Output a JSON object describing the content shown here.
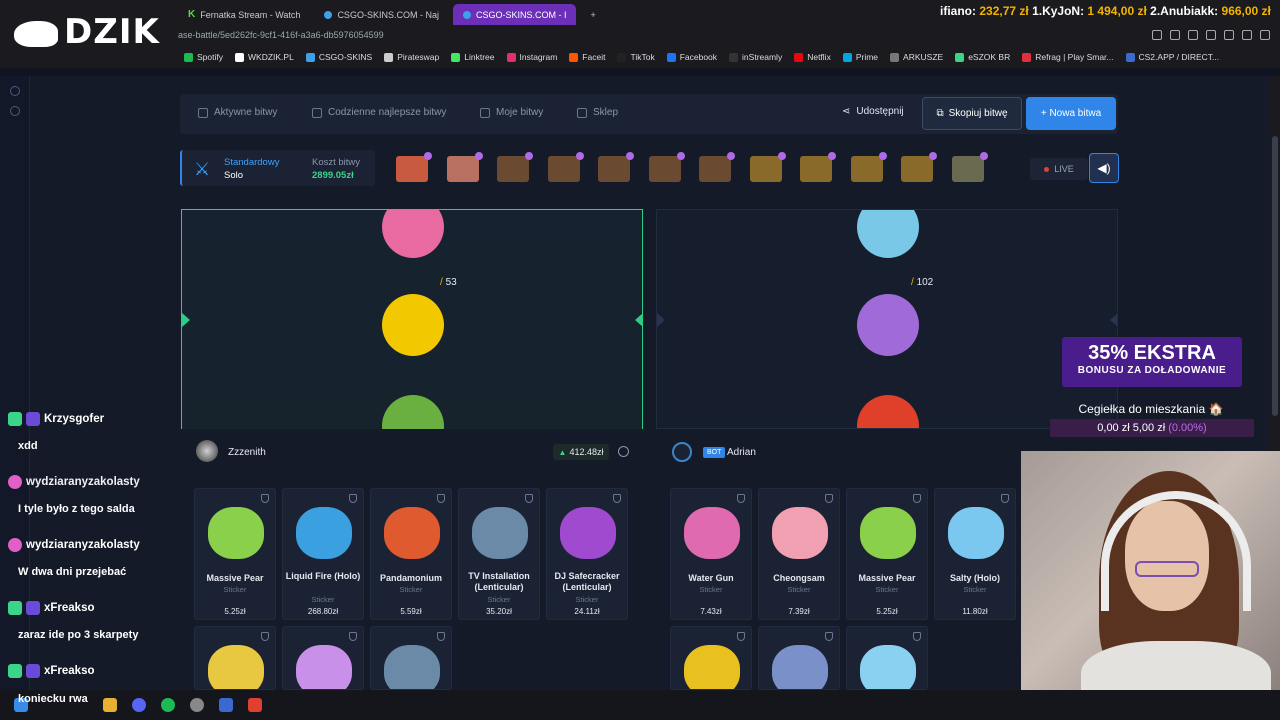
{
  "browser": {
    "logo": "DZIK",
    "tabs": [
      {
        "label": "Fernatka Stream - Watch",
        "active": false
      },
      {
        "label": "CSGO-SKINS.COM - Naj",
        "active": false
      },
      {
        "label": "CSGO-SKINS.COM - I",
        "active": true
      }
    ],
    "url": "ase-battle/5ed262fc-9cf1-416f-a3a6-db5976054599",
    "ticker": {
      "label": "ifiano:",
      "v1": "232,77 zł",
      "t2": "1.KyJoN:",
      "v2": "1 494,00 zł",
      "t3": "2.Anubiakk:",
      "v3": "966,00 zł"
    },
    "bookmarks": [
      "Spotify",
      "WKDZIK.PL",
      "CSGO-SKINS",
      "Pirateswap",
      "Linktree",
      "Instagram",
      "Faceit",
      "TikTok",
      "Facebook",
      "inStreamly",
      "Netflix",
      "Prime",
      "ARKUSZE",
      "eSZOK BR",
      "Refrag | Play Smar...",
      "CS2.APP / DIRECT..."
    ]
  },
  "nav": {
    "items": [
      "Aktywne bitwy",
      "Codzienne najlepsze bitwy",
      "Moje bitwy",
      "Sklep"
    ],
    "share": "Udostępnij",
    "copy": "Skopiuj bitwę",
    "new": "+ Nowa bitwa"
  },
  "mode": {
    "type": "Standardowy",
    "sub": "Solo",
    "cost_label": "Koszt bitwy",
    "cost": "2899.05zł"
  },
  "live": "LIVE",
  "reels": {
    "left_value": "53",
    "right_value": "102"
  },
  "players": {
    "p1": {
      "name": "Zzzenith",
      "total": "412.48zł"
    },
    "p2": {
      "bot": "BOT",
      "name": "Adrian"
    }
  },
  "cards_left": [
    {
      "name": "Massive Pear",
      "type": "Sticker",
      "price": "5.25zł",
      "color": "#8bd04a"
    },
    {
      "name": "Liquid Fire (Holo)",
      "type": "Sticker",
      "price": "268.80zł",
      "color": "#3aa0e0"
    },
    {
      "name": "Pandamonium",
      "type": "Sticker",
      "price": "5.59zł",
      "color": "#e05a30"
    },
    {
      "name": "TV Installation (Lenticular)",
      "type": "Sticker",
      "price": "35.20zł",
      "color": "#6a8aa8"
    },
    {
      "name": "DJ Safecracker (Lenticular)",
      "type": "Sticker",
      "price": "24.11zł",
      "color": "#a04ad0"
    }
  ],
  "cards_right": [
    {
      "name": "Water Gun",
      "type": "Sticker",
      "price": "7.43zł",
      "color": "#e06ab0"
    },
    {
      "name": "Cheongsam",
      "type": "Sticker",
      "price": "7.39zł",
      "color": "#f0a0b0"
    },
    {
      "name": "Massive Pear",
      "type": "Sticker",
      "price": "5.25zł",
      "color": "#8bd04a"
    },
    {
      "name": "Salty (Holo)",
      "type": "Sticker",
      "price": "11.80zł",
      "color": "#7ac8f0"
    }
  ],
  "promo": {
    "big": "35% EKSTRA",
    "small": "BONUSU ZA DOŁADOWANIE",
    "goal": "Cegiełka do mieszkania 🏠",
    "progress": "0,00 zł 5,00 zł",
    "percent": "(0.00%)"
  },
  "chat": [
    {
      "user": "Krzysgofer",
      "msg": "xdd"
    },
    {
      "user": "wydziaranyzakolasty",
      "msg": "I tyle było z tego salda"
    },
    {
      "user": "wydziaranyzakolasty",
      "msg": "W dwa dni przejebać"
    },
    {
      "user": "xFreakso",
      "msg": "zaraz ide po 3 skarpety"
    },
    {
      "user": "xFreakso",
      "msg": "koniecku rwa"
    }
  ]
}
